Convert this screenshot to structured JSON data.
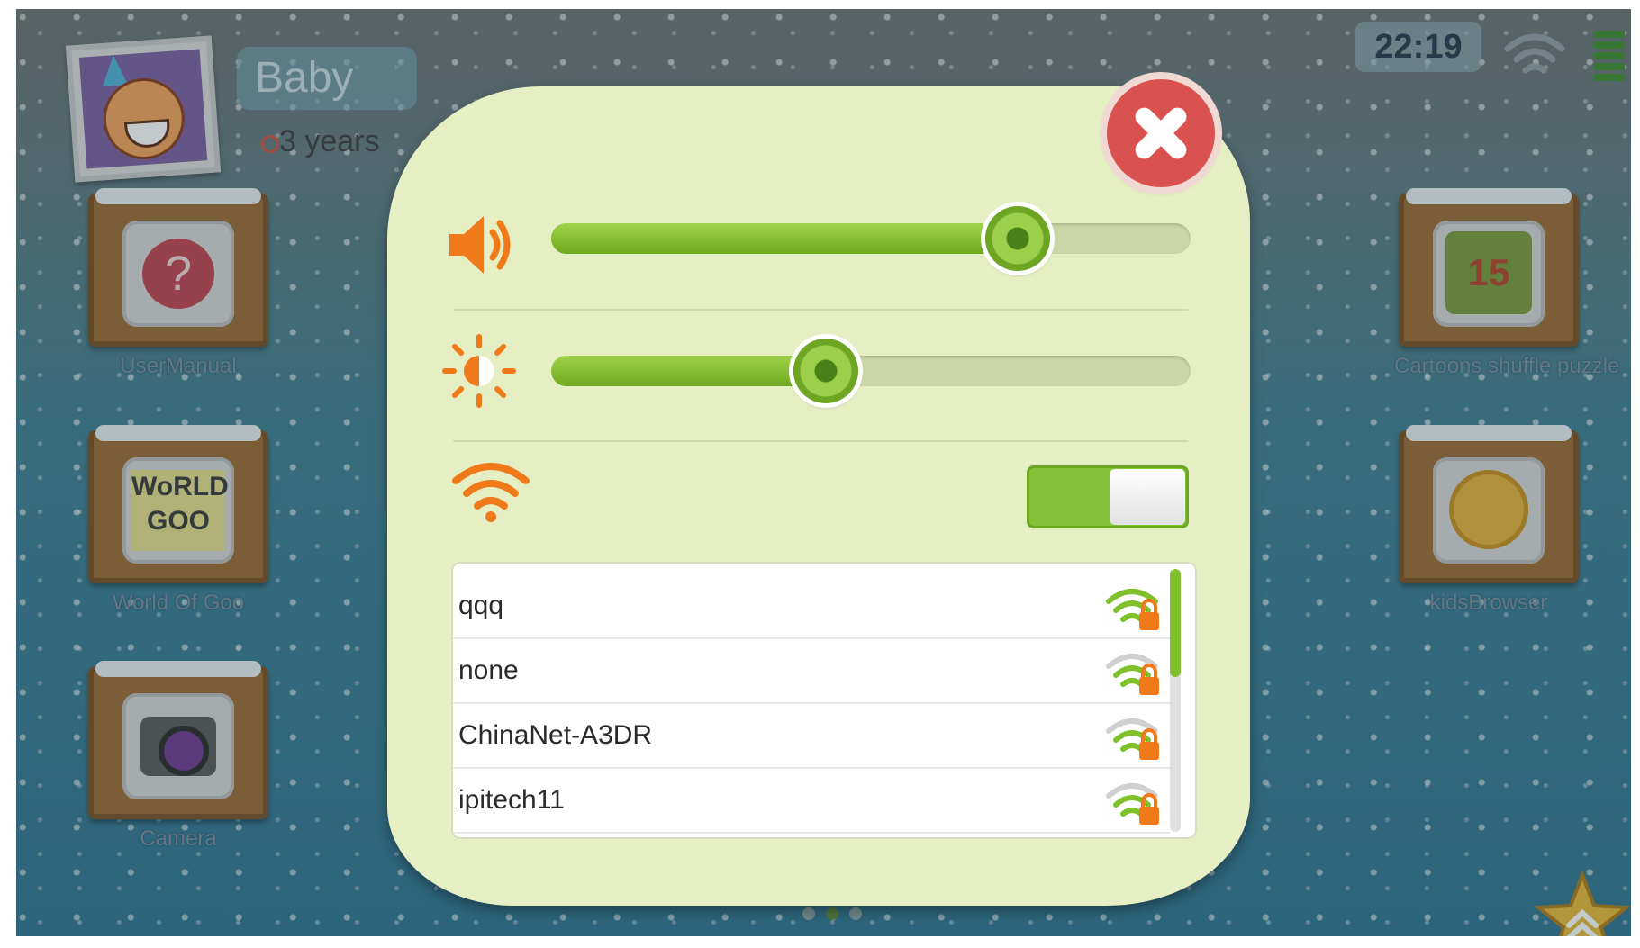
{
  "status_bar": {
    "time": "22:19"
  },
  "profile": {
    "name": "Baby",
    "age": "3 years"
  },
  "apps": [
    {
      "label": "UserManual",
      "icon": "help-icon"
    },
    {
      "label": "World Of Goo",
      "icon": "world-of-goo-icon",
      "glyph": "WoRLD GOO"
    },
    {
      "label": "Camera",
      "icon": "camera-icon"
    },
    {
      "label": "Cartoons shuffle puzzle",
      "icon": "puzzle-icon",
      "glyph": "15"
    },
    {
      "label": "kidsBrowser",
      "icon": "globe-icon"
    }
  ],
  "settings_dialog": {
    "volume_level_percent": 73,
    "brightness_level_percent": 43,
    "wifi_enabled": true,
    "networks": [
      {
        "ssid": "qqq",
        "secured": true
      },
      {
        "ssid": "none",
        "secured": true
      },
      {
        "ssid": "ChinaNet-A3DR",
        "secured": true
      },
      {
        "ssid": "ipitech11",
        "secured": true
      }
    ]
  },
  "colors": {
    "accent_green": "#7fc02b",
    "icon_orange": "#f07a1a",
    "close_red": "#d9524f",
    "dialog_bg": "#e6efc4"
  }
}
